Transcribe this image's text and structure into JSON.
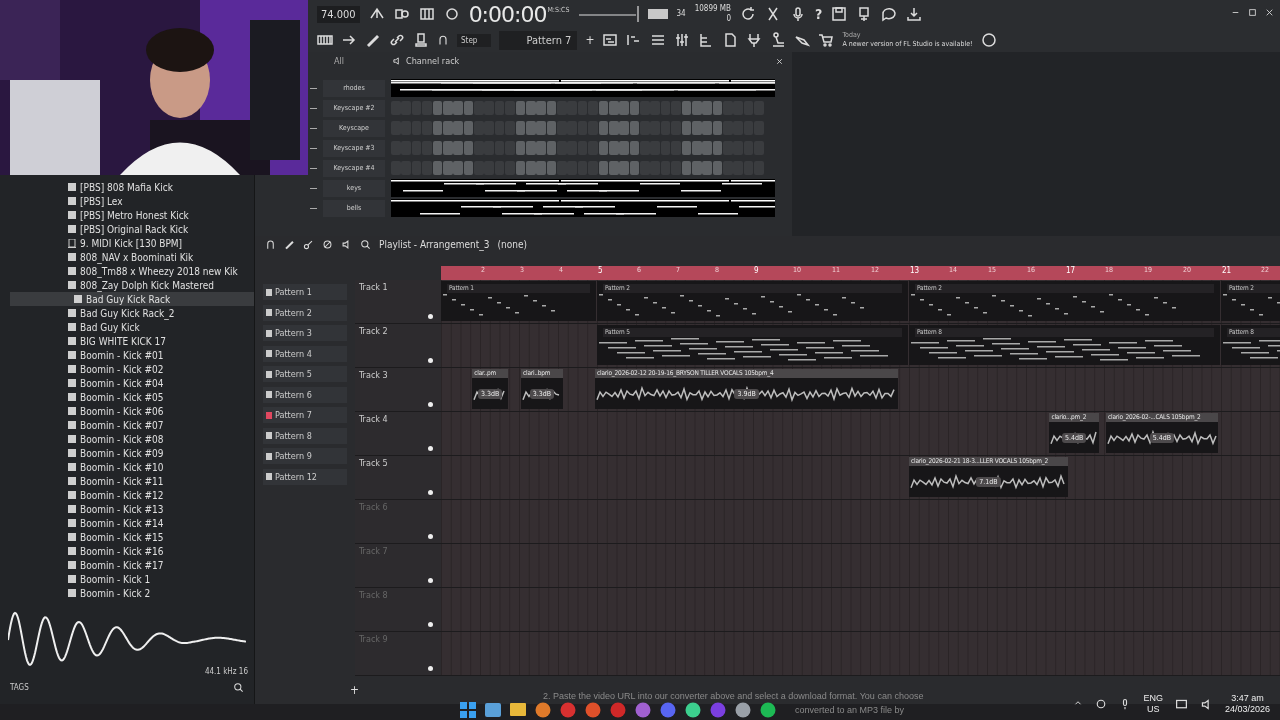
{
  "toolbar": {
    "tempo": "74.000",
    "time": "0:00:00",
    "time_unit": "M:S:CS",
    "cpu": "34",
    "memory": "10899 MB",
    "polyphony": "0",
    "help": "?",
    "snap": "Step",
    "pattern": "Pattern 7",
    "add": "+",
    "news_date": "Today",
    "news": "A newer version of FL Studio is available!"
  },
  "channel_rack": {
    "filter": "All",
    "title": "Channel rack",
    "channels": [
      {
        "name": "rhodes",
        "kind": "piano_roll"
      },
      {
        "name": "Keyscape #2",
        "kind": "steps",
        "steps": [
          false,
          false,
          false,
          false,
          true,
          true,
          true,
          true,
          false,
          false,
          false,
          false,
          true,
          true,
          true,
          true,
          false,
          false,
          false,
          false,
          true,
          true,
          true,
          true,
          false,
          false,
          false,
          false,
          true,
          true,
          true,
          true,
          false,
          false,
          false,
          false
        ]
      },
      {
        "name": "Keyscape",
        "kind": "steps",
        "steps": [
          false,
          false,
          false,
          false,
          true,
          true,
          true,
          true,
          false,
          false,
          false,
          false,
          true,
          true,
          true,
          true,
          false,
          false,
          false,
          false,
          true,
          true,
          true,
          true,
          false,
          false,
          false,
          false,
          true,
          true,
          true,
          true,
          false,
          false,
          false,
          false
        ]
      },
      {
        "name": "Keyscape #3",
        "kind": "steps",
        "steps": [
          false,
          false,
          false,
          false,
          true,
          true,
          true,
          true,
          false,
          false,
          false,
          false,
          true,
          true,
          true,
          true,
          false,
          false,
          false,
          false,
          true,
          true,
          true,
          true,
          false,
          false,
          false,
          false,
          true,
          true,
          true,
          true,
          false,
          false,
          false,
          false
        ]
      },
      {
        "name": "Keyscape #4",
        "kind": "steps",
        "steps": [
          false,
          false,
          false,
          false,
          true,
          true,
          true,
          true,
          false,
          false,
          false,
          false,
          true,
          true,
          true,
          true,
          false,
          false,
          false,
          false,
          true,
          true,
          true,
          true,
          false,
          false,
          false,
          false,
          true,
          true,
          true,
          true,
          false,
          false,
          false,
          false
        ]
      },
      {
        "name": "keys",
        "kind": "piano_roll"
      },
      {
        "name": "bells",
        "kind": "piano_roll"
      }
    ]
  },
  "browser": {
    "items": [
      {
        "name": "[PBS] 808 Mafia Kick",
        "kind": "sample",
        "selected": false
      },
      {
        "name": "[PBS] Lex",
        "kind": "sample",
        "selected": false
      },
      {
        "name": "[PBS] Metro Honest Kick",
        "kind": "sample",
        "selected": false
      },
      {
        "name": "[PBS] Original Rack Kick",
        "kind": "sample",
        "selected": false
      },
      {
        "name": "9. MIDI Kick [130 BPM]",
        "kind": "midi",
        "selected": false
      },
      {
        "name": "808_NAV x Boominati Kik",
        "kind": "sample",
        "selected": false
      },
      {
        "name": "808_Tm88 x Wheezy 2018 new Kik",
        "kind": "sample",
        "selected": false
      },
      {
        "name": "808_Zay Dolph Kick Mastered",
        "kind": "sample",
        "selected": false
      },
      {
        "name": "Bad Guy Kick Rack",
        "kind": "sample",
        "selected": true
      },
      {
        "name": "Bad Guy Kick Rack_2",
        "kind": "sample",
        "selected": false
      },
      {
        "name": "Bad Guy Kick",
        "kind": "sample",
        "selected": false
      },
      {
        "name": "BIG WHITE KICK 17",
        "kind": "sample",
        "selected": false
      },
      {
        "name": "Boomin - Kick #01",
        "kind": "sample",
        "selected": false
      },
      {
        "name": "Boomin - Kick #02",
        "kind": "sample",
        "selected": false
      },
      {
        "name": "Boomin - Kick #04",
        "kind": "sample",
        "selected": false
      },
      {
        "name": "Boomin - Kick #05",
        "kind": "sample",
        "selected": false
      },
      {
        "name": "Boomin - Kick #06",
        "kind": "sample",
        "selected": false
      },
      {
        "name": "Boomin - Kick #07",
        "kind": "sample",
        "selected": false
      },
      {
        "name": "Boomin - Kick #08",
        "kind": "sample",
        "selected": false
      },
      {
        "name": "Boomin - Kick #09",
        "kind": "sample",
        "selected": false
      },
      {
        "name": "Boomin - Kick #10",
        "kind": "sample",
        "selected": false
      },
      {
        "name": "Boomin - Kick #11",
        "kind": "sample",
        "selected": false
      },
      {
        "name": "Boomin - Kick #12",
        "kind": "sample",
        "selected": false
      },
      {
        "name": "Boomin - Kick #13",
        "kind": "sample",
        "selected": false
      },
      {
        "name": "Boomin - Kick #14",
        "kind": "sample",
        "selected": false
      },
      {
        "name": "Boomin - Kick #15",
        "kind": "sample",
        "selected": false
      },
      {
        "name": "Boomin - Kick #16",
        "kind": "sample",
        "selected": false
      },
      {
        "name": "Boomin - Kick #17",
        "kind": "sample",
        "selected": false
      },
      {
        "name": "Boomin - Kick 1",
        "kind": "sample",
        "selected": false
      },
      {
        "name": "Boomin - Kick 2",
        "kind": "sample",
        "selected": false
      }
    ],
    "sample_info": "44.1 kHz 16",
    "tags": "TAGS"
  },
  "playlist": {
    "title": "Playlist - Arrangement_3",
    "arrangement": "(none)",
    "add": "+",
    "ruler": [
      "2",
      "3",
      "4",
      "5",
      "6",
      "7",
      "8",
      "9",
      "10",
      "11",
      "12",
      "13",
      "14",
      "15",
      "16",
      "17",
      "18",
      "19",
      "20",
      "21",
      "22"
    ],
    "patterns": [
      {
        "name": "Pattern 1",
        "selected": false
      },
      {
        "name": "Pattern 2",
        "selected": false
      },
      {
        "name": "Pattern 3",
        "selected": false
      },
      {
        "name": "Pattern 4",
        "selected": false
      },
      {
        "name": "Pattern 5",
        "selected": false
      },
      {
        "name": "Pattern 6",
        "selected": false
      },
      {
        "name": "Pattern 7",
        "selected": true
      },
      {
        "name": "Pattern 8",
        "selected": false
      },
      {
        "name": "Pattern 9",
        "selected": false
      },
      {
        "name": "Pattern 12",
        "selected": false
      }
    ],
    "tracks": [
      {
        "name": "Track 1",
        "empty": false,
        "clips": [
          {
            "kind": "pattern",
            "label": "Pattern 1"
          },
          {
            "kind": "pattern",
            "label": "Pattern 2"
          },
          {
            "kind": "pattern",
            "label": "Pattern 2"
          },
          {
            "kind": "pattern",
            "label": "Pattern 2"
          }
        ]
      },
      {
        "name": "Track 2",
        "empty": false,
        "clips": [
          {
            "kind": "pattern",
            "label": "Pattern 5"
          },
          {
            "kind": "pattern",
            "label": "Pattern 8"
          },
          {
            "kind": "pattern",
            "label": "Pattern 8"
          }
        ]
      },
      {
        "name": "Track 3",
        "empty": false,
        "clips": [
          {
            "kind": "audio",
            "label": "clar..pm",
            "gain": "3.3dB"
          },
          {
            "kind": "audio",
            "label": "clari..bpm",
            "gain": "3.3dB"
          },
          {
            "kind": "audio",
            "label": "clario_2026-02-12 20-19-16_BRYSON TILLER VOCALS 105bpm_4",
            "gain": "3.9dB"
          }
        ]
      },
      {
        "name": "Track 4",
        "empty": false,
        "clips": [
          {
            "kind": "audio",
            "label": "clario...pm_2",
            "gain": "5.4dB"
          },
          {
            "kind": "audio",
            "label": "clario_2026-02-...CALS 105bpm_2",
            "gain": "5.4dB"
          }
        ]
      },
      {
        "name": "Track 5",
        "empty": false,
        "clips": [
          {
            "kind": "audio",
            "label": "clario_2026-02-21 18-3...LLER VOCALS 105bpm_2",
            "gain": "7.1dB"
          }
        ]
      },
      {
        "name": "Track 6",
        "empty": true
      },
      {
        "name": "Track 7",
        "empty": true
      },
      {
        "name": "Track 8",
        "empty": true
      },
      {
        "name": "Track 9",
        "empty": true
      }
    ]
  },
  "taskbar": {
    "page_text": "2. Paste the video URL into our converter above and select a download format. You can choose",
    "page_text_fragment": "converted to an MP3 file by",
    "language": "ENG",
    "region": "US",
    "time": "3:47 am",
    "date": "24/03/2026"
  }
}
